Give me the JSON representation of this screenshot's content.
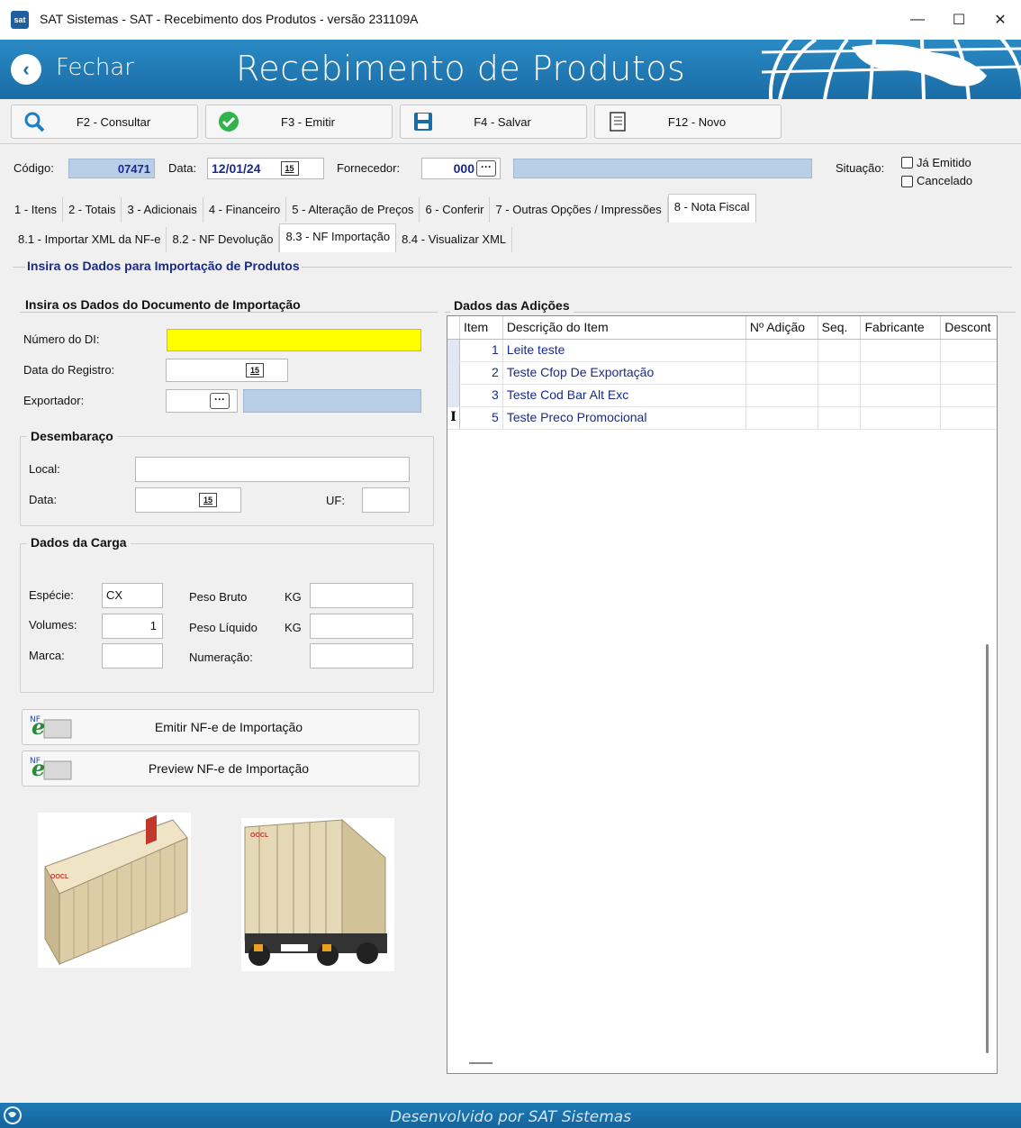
{
  "window": {
    "app_icon_text": "sat",
    "title": "SAT Sistemas - SAT - Recebimento dos Produtos - versão 231109A",
    "minimize": "—",
    "maximize": "☐",
    "close": "✕"
  },
  "banner": {
    "back_label": "Fechar",
    "title": "Recebimento de Produtos"
  },
  "toolbar": {
    "consultar": "F2 - Consultar",
    "emitir": "F3 - Emitir",
    "salvar": "F4 - Salvar",
    "novo": "F12 - Novo"
  },
  "header": {
    "codigo_label": "Código:",
    "codigo_value": "07471",
    "data_label": "Data:",
    "data_value": "12/01/24",
    "fornecedor_label": "Fornecedor:",
    "fornecedor_value": "000",
    "situacao_label": "Situação:",
    "ja_emitido": "Já Emitido",
    "cancelado": "Cancelado"
  },
  "tabs": [
    "1 - Itens",
    "2 - Totais",
    "3 - Adicionais",
    "4 - Financeiro",
    "5 - Alteração de Preços",
    "6 - Conferir",
    "7 - Outras Opções / Impressões",
    "8 - Nota Fiscal"
  ],
  "subtabs": [
    "8.1 - Importar XML da NF-e",
    "8.2 - NF Devolução",
    "8.3 - NF Importação",
    "8.4 - Visualizar XML"
  ],
  "calendar_icon_text": "15",
  "dots_text": "···",
  "section_title": "Insira os Dados para Importação de Produtos",
  "doc": {
    "title": "Insira os Dados do Documento de Importação",
    "numero_di": "Número do DI:",
    "data_registro": "Data do Registro:",
    "exportador": "Exportador:"
  },
  "desembaraco": {
    "title": "Desembaraço",
    "local": "Local:",
    "data": "Data:",
    "uf": "UF:"
  },
  "carga": {
    "title": "Dados da Carga",
    "especie_label": "Espécie:",
    "especie_value": "CX",
    "volumes_label": "Volumes:",
    "volumes_value": "1",
    "marca_label": "Marca:",
    "peso_bruto": "Peso Bruto",
    "peso_liquido": "Peso Líquido",
    "kg": "KG",
    "numeracao": "Numeração:"
  },
  "buttons": {
    "emitir": "Emitir NF-e de Importação",
    "preview": "Preview NF-e de Importação"
  },
  "adicoes": {
    "title": "Dados das Adições",
    "columns": [
      "Item",
      "Descrição do Item",
      "Nº Adição",
      "Seq.",
      "Fabricante",
      "Descont"
    ],
    "rows": [
      {
        "indicator": "",
        "item": "1",
        "descricao": "Leite teste"
      },
      {
        "indicator": "",
        "item": "2",
        "descricao": "Teste Cfop De Exportação"
      },
      {
        "indicator": "",
        "item": "3",
        "descricao": "Teste Cod Bar Alt Exc"
      },
      {
        "indicator": "I",
        "item": "5",
        "descricao": "Teste Preco Promocional"
      }
    ]
  },
  "container_logo_text": "OOCL",
  "footer": "Desenvolvido por SAT Sistemas",
  "colors": {
    "banner": "#1a6ca6",
    "input_blue": "#b9cfe8",
    "di_yellow": "#ffff00",
    "text_blue": "#1a2a8c"
  }
}
